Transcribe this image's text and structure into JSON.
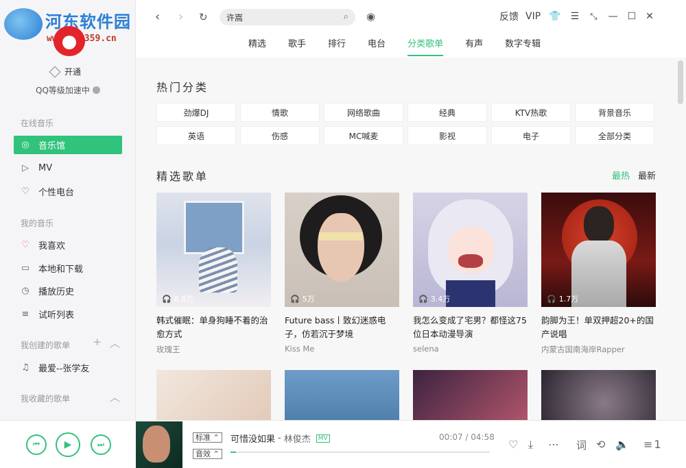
{
  "brand": {
    "title": "河东软件园",
    "url": "www.pc0359.cn"
  },
  "sidebar": {
    "vip_label": "开通",
    "qq_speed": "QQ等级加速中",
    "section_online": "在线音乐",
    "online_items": [
      {
        "label": "音乐馆",
        "icon": "music-hall-icon"
      },
      {
        "label": "MV",
        "icon": "mv-icon"
      },
      {
        "label": "个性电台",
        "icon": "radio-icon"
      }
    ],
    "section_my": "我的音乐",
    "my_items": [
      {
        "label": "我喜欢",
        "icon": "heart-icon"
      },
      {
        "label": "本地和下载",
        "icon": "monitor-icon"
      },
      {
        "label": "播放历史",
        "icon": "clock-icon"
      },
      {
        "label": "试听列表",
        "icon": "playlist-icon"
      }
    ],
    "section_created": "我创建的歌单",
    "created_items": [
      {
        "label": "最爱--张学友",
        "icon": "note-icon"
      }
    ],
    "section_collected": "我收藏的歌单"
  },
  "topbar": {
    "search_value": "许嵩",
    "feedback": "反馈",
    "vip": "VIP",
    "tabs": [
      "精选",
      "歌手",
      "排行",
      "电台",
      "分类歌单",
      "有声",
      "数字专辑"
    ],
    "active_tab": "分类歌单"
  },
  "hot_categories": {
    "title": "热门分类",
    "items": [
      "劲爆DJ",
      "情歌",
      "网络歌曲",
      "经典",
      "KTV热歌",
      "背景音乐",
      "英语",
      "伤感",
      "MC喊麦",
      "影视",
      "电子",
      "全部分类"
    ]
  },
  "featured": {
    "title": "精选歌单",
    "sort_hot": "最热",
    "sort_new": "最新",
    "playlists": [
      {
        "title": "韩式催眠：单身狗睡不着的治愈方式",
        "author": "玫瑰王",
        "plays": "8.8万"
      },
      {
        "title": "Future bass丨致幻迷惑电子，仿若沉于梦境",
        "author": "Kiss Me",
        "plays": "5万"
      },
      {
        "title": "我怎么变成了宅男？都怪这75位日本动漫导演",
        "author": "selena",
        "plays": "3.4万"
      },
      {
        "title": "韵脚为王！单双押超20+的国产说唱",
        "author": "内蒙古国南海岸Rapper",
        "plays": "1.7万"
      }
    ]
  },
  "player": {
    "quality": "标准",
    "effect": "音效",
    "song": "可惜没如果",
    "separator": "-",
    "artist": "林俊杰",
    "mv": "MV",
    "current_time": "00:07",
    "total_time": "04:58",
    "time_sep": " / ",
    "lyrics": "词",
    "queue_count": "1",
    "progress_fraction": 0.02
  },
  "colors": {
    "accent": "#31c27c",
    "sidebar_bg": "#f5f5f7",
    "content_bg": "#f7f7f7"
  }
}
